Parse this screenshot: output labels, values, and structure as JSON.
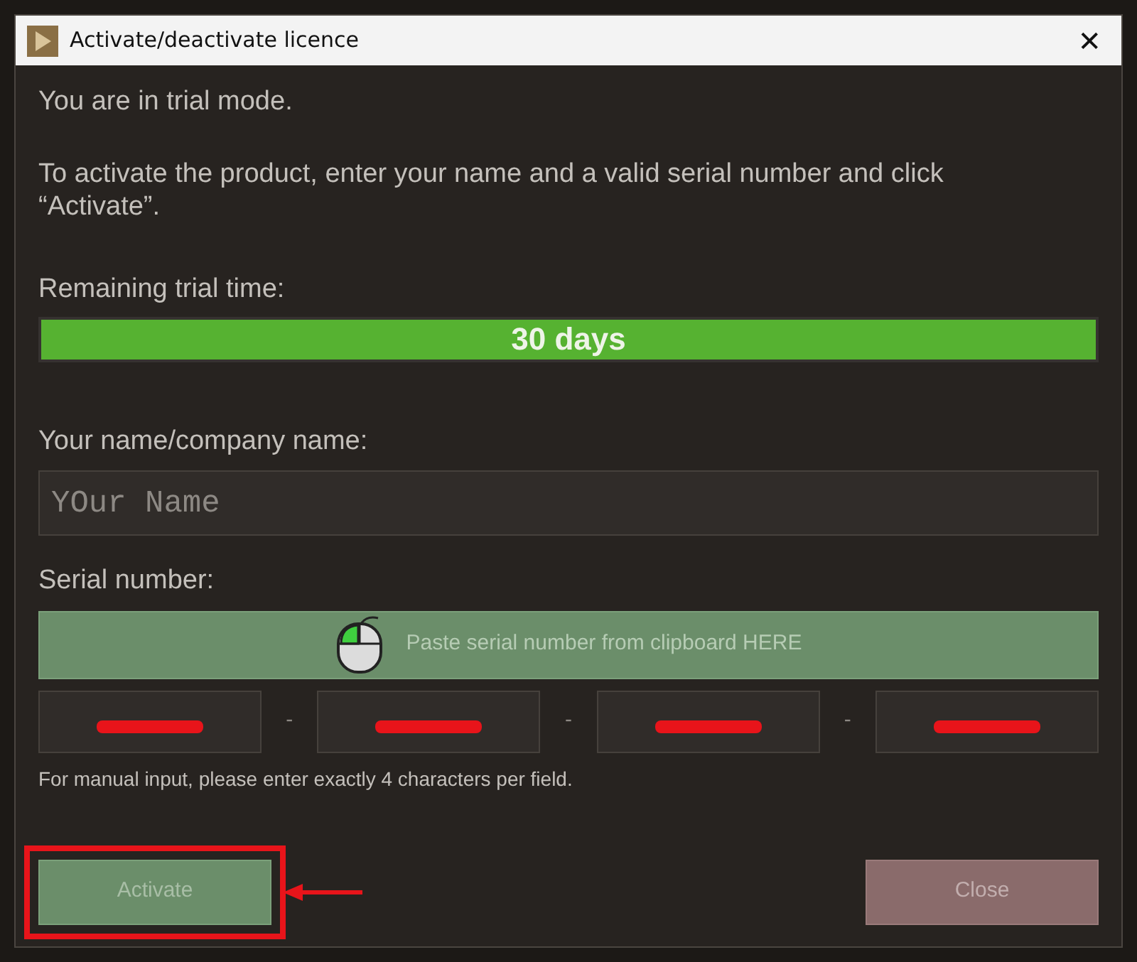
{
  "window": {
    "title": "Activate/deactivate licence",
    "close": "✕"
  },
  "intro": "You are in trial mode.",
  "instructions": "To activate the product, enter your name and a valid serial number and click “Activate”.",
  "trial": {
    "label": "Remaining trial time:",
    "reading": "30 days",
    "level": 1
  },
  "name_field": {
    "label": "Your name/company name:",
    "value": "YOur Name"
  },
  "serial": {
    "label": "Serial number:",
    "paste": "Paste serial number from clipboard HERE",
    "separator": "-",
    "fields": [
      {
        "redacted": true
      },
      {
        "redacted": true
      },
      {
        "redacted": true
      },
      {
        "redacted": true
      }
    ],
    "hint": "For manual input, please enter exactly 4 characters per field."
  },
  "buttons": [
    {
      "label": "Activate",
      "kind": "activate",
      "highlighted": true
    },
    {
      "label": "Close",
      "kind": "close",
      "highlighted": false
    }
  ]
}
